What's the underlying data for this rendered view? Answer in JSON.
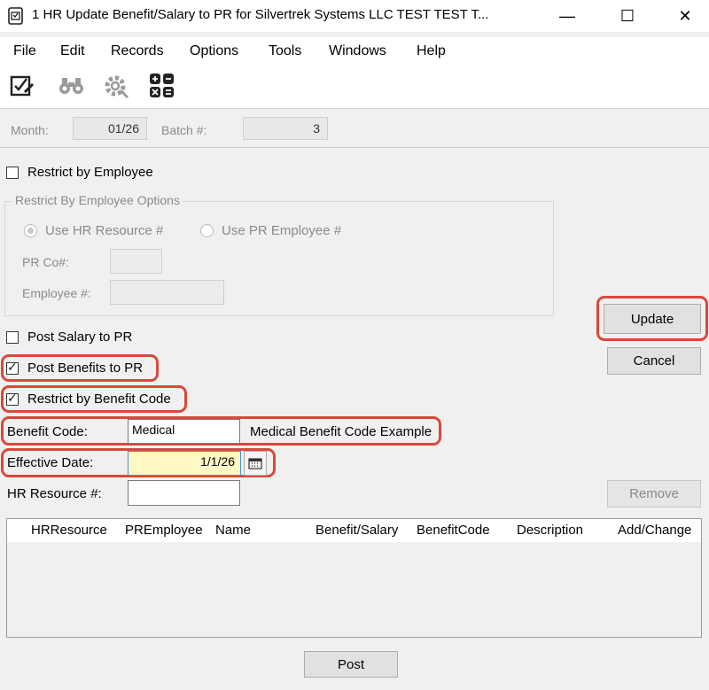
{
  "window": {
    "title": "1 HR Update Benefit/Salary to PR for Silvertrek Systems LLC TEST TEST T...",
    "minimize": "—",
    "maximize": "☐",
    "close": "✕"
  },
  "menu": [
    "File",
    "Edit",
    "Records",
    "Options",
    "Tools",
    "Windows",
    "Help"
  ],
  "toolbar": {
    "icons": [
      "edit-checkbox-icon",
      "binoculars-icon",
      "settings-icon",
      "calculator-icon"
    ]
  },
  "header": {
    "month_label": "Month:",
    "month_value": "01/26",
    "batch_label": "Batch #:",
    "batch_value": "3"
  },
  "restrict_employee": {
    "label": "Restrict by Employee",
    "checked": false
  },
  "employee_options": {
    "title": "Restrict By Employee Options",
    "use_hr_label": "Use HR Resource #",
    "use_pr_label": "Use PR Employee #",
    "prco_label": "PR Co#:",
    "prco_value": "",
    "employee_label": "Employee #:",
    "employee_value": ""
  },
  "post_salary": {
    "label": "Post Salary to PR",
    "checked": false
  },
  "post_benefits": {
    "label": "Post Benefits to PR",
    "checked": true
  },
  "restrict_benefit": {
    "label": "Restrict by Benefit Code",
    "checked": true
  },
  "benefit_code": {
    "label": "Benefit Code:",
    "value": "Medical",
    "description": "Medical Benefit Code Example"
  },
  "effective_date": {
    "label": "Effective Date:",
    "value": "1/1/26"
  },
  "hr_resource": {
    "label": "HR Resource #:",
    "value": ""
  },
  "buttons": {
    "update": "Update",
    "cancel": "Cancel",
    "remove": "Remove",
    "post": "Post"
  },
  "grid": {
    "columns": [
      "HRResource",
      "PREmployee",
      "Name",
      "Benefit/Salary",
      "BenefitCode",
      "Description",
      "Add/Change"
    ],
    "rows": []
  },
  "colors": {
    "highlight": "#d9483b",
    "date_field": "#fff8c4"
  }
}
